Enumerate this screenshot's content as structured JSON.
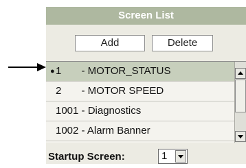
{
  "panel": {
    "title": "Screen List",
    "add_label": "Add",
    "delete_label": "Delete",
    "items": [
      {
        "label": "1       - MOTOR_STATUS",
        "selected": true
      },
      {
        "label": "2       - MOTOR SPEED",
        "selected": false
      },
      {
        "label": "1001 - Diagnostics",
        "selected": false
      },
      {
        "label": "1002 - Alarm Banner",
        "selected": false
      }
    ],
    "startup_label": "Startup Screen:",
    "startup_value": "1"
  },
  "colors": {
    "header_bg": "#aeb8a0",
    "panel_bg": "#ecebe3",
    "selected_bg": "#c7cfbc"
  },
  "icons": {
    "pointer": "arrow-right-icon",
    "selection": "bullet-icon",
    "scroll_up": "scroll-up-arrow-icon",
    "scroll_down": "scroll-down-arrow-icon",
    "dropdown": "chevron-down-icon"
  }
}
